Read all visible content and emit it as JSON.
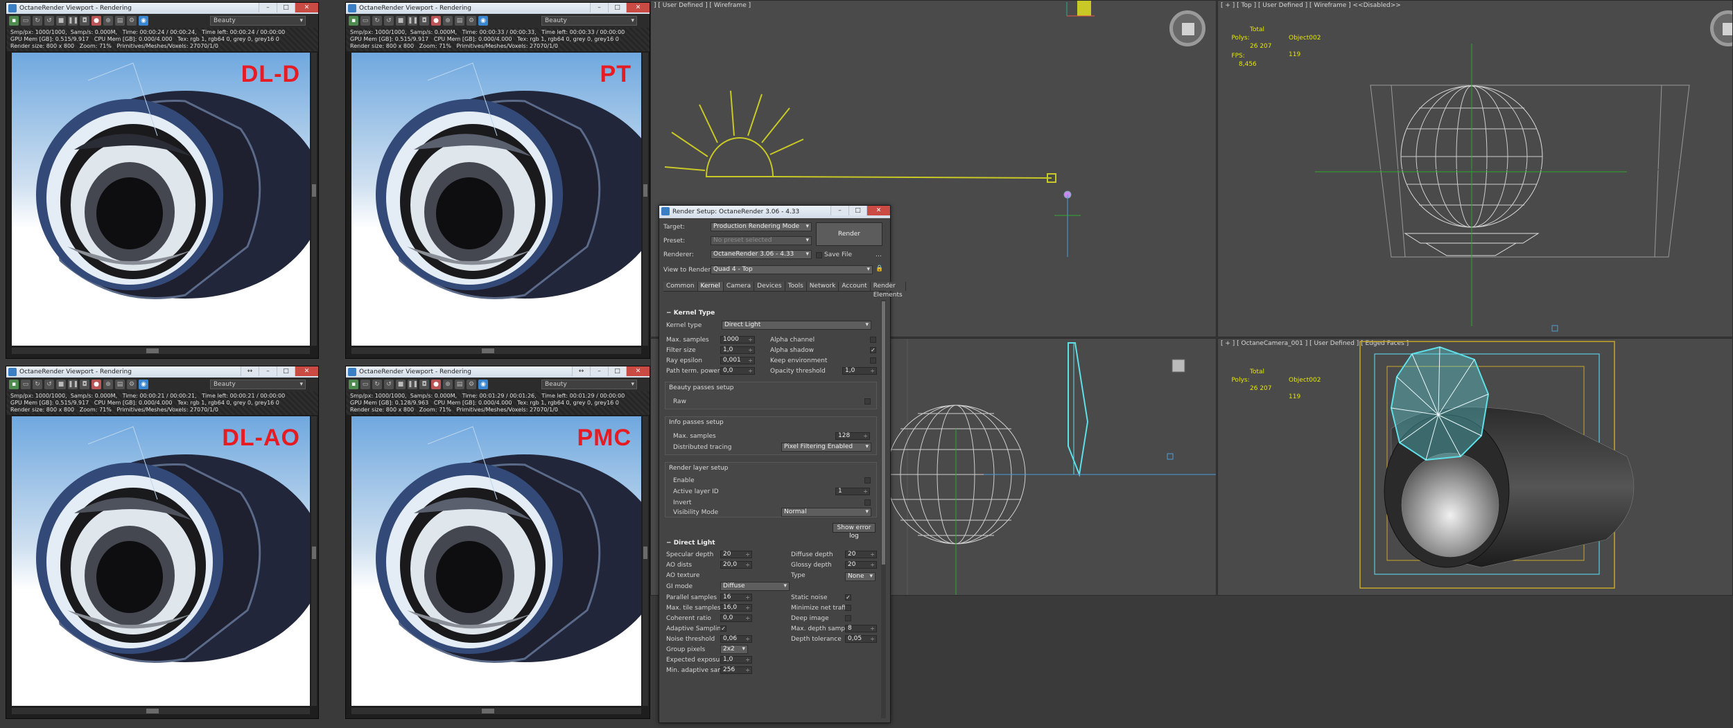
{
  "viewports": {
    "top_left_label": "] [ User Defined ] [ Wireframe ]",
    "top_right_label": "[ + ] [ Top ] [ User Defined ] [ Wireframe ] <<Disabled>>",
    "bottom_right_label": "[ + ] [ OctaneCamera_001 ] [ User Defined ] [ Edged Faces ]",
    "stats_top": {
      "col1": "Total",
      "col2": "Object002",
      "polys_label": "Polys:",
      "polys_total": "26 207",
      "polys_obj": "119",
      "fps_label": "FPS:",
      "fps_value": "8,456"
    },
    "stats_cam": {
      "col1": "Total",
      "col2": "Object002",
      "polys_label": "Polys:",
      "polys_total": "26 207",
      "polys_obj": "119"
    }
  },
  "octane_windows": [
    {
      "title": "OctaneRender Viewport - Rendering",
      "pass": "Beauty",
      "mode": "DL-D",
      "line1": "Smp/px: 1000/1000,  Samp/s: 0.000M,   Time: 00:00:24 / 00:00:24,   Time left: 00:00:24 / 00:00:00",
      "line2": "GPU Mem [GB]: 0.515/9.917   CPU Mem [GB]: 0.000/4.000   Tex: rgb 1, rgb64 0, grey 0, grey16 0",
      "line3": "Render size: 800 x 800   Zoom: 71%   Primitives/Meshes/Voxels: 27070/1/0"
    },
    {
      "title": "OctaneRender Viewport - Rendering",
      "pass": "Beauty",
      "mode": "PT",
      "line1": "Smp/px: 1000/1000,  Samp/s: 0.000M,   Time: 00:00:33 / 00:00:33,   Time left: 00:00:33 / 00:00:00",
      "line2": "GPU Mem [GB]: 0.515/9.917   CPU Mem [GB]: 0.000/4.000   Tex: rgb 1, rgb64 0, grey 0, grey16 0",
      "line3": "Render size: 800 x 800   Zoom: 71%   Primitives/Meshes/Voxels: 27070/1/0"
    },
    {
      "title": "OctaneRender Viewport - Rendering",
      "pass": "Beauty",
      "mode": "DL-AO",
      "line1": "Smp/px: 1000/1000,  Samp/s: 0.000M,   Time: 00:00:21 / 00:00:21,   Time left: 00:00:21 / 00:00:00",
      "line2": "GPU Mem [GB]: 0.515/9.917   CPU Mem [GB]: 0.000/4.000   Tex: rgb 1, rgb64 0, grey 0, grey16 0",
      "line3": "Render size: 800 x 800   Zoom: 71%   Primitives/Meshes/Voxels: 27070/1/0"
    },
    {
      "title": "OctaneRender Viewport - Rendering",
      "pass": "Beauty",
      "mode": "PMC",
      "line1": "Smp/px: 1000/1000,  Samp/s: 0.000M,   Time: 00:01:29 / 00:01:26,   Time left: 00:01:29 / 00:00:00",
      "line2": "GPU Mem [GB]: 0.128/9.963   CPU Mem [GB]: 0.000/4.000   Tex: rgb 1, rgb64 0, grey 0, grey16 0",
      "line3": "Render size: 800 x 800   Zoom: 71%   Primitives/Meshes/Voxels: 27070/1/0"
    }
  ],
  "render_setup": {
    "title": "Render Setup: OctaneRender 3.06 - 4.33",
    "target_label": "Target:",
    "target_value": "Production Rendering Mode",
    "preset_label": "Preset:",
    "preset_value": "No preset selected",
    "renderer_label": "Renderer:",
    "renderer_value": "OctaneRender 3.06 - 4.33",
    "save_file": "Save File",
    "view_label": "View to Render:",
    "view_value": "Quad 4 - Top",
    "render_button": "Render",
    "tabs": [
      "Common",
      "Kernel",
      "Camera",
      "Devices",
      "Tools",
      "Network",
      "Account",
      "Render Elements"
    ],
    "kernel": {
      "header": "Kernel Type",
      "kernel_type_label": "Kernel type",
      "kernel_type_value": "Direct Light",
      "max_samples_label": "Max. samples",
      "max_samples": "1000",
      "filter_size_label": "Filter size",
      "filter_size": "1,0",
      "ray_epsilon_label": "Ray epsilon",
      "ray_epsilon": "0,001",
      "path_term_label": "Path term. power",
      "path_term": "0,0",
      "alpha_channel_label": "Alpha channel",
      "alpha_shadow_label": "Alpha shadow",
      "keep_env_label": "Keep environment",
      "opacity_label": "Opacity threshold",
      "opacity": "1,0"
    },
    "beauty": {
      "header": "Beauty passes setup",
      "raw_label": "Raw"
    },
    "info": {
      "header": "Info passes setup",
      "max_samples_label": "Max. samples",
      "max_samples": "128",
      "dist_label": "Distributed tracing",
      "dist_value": "Pixel Filtering Enabled"
    },
    "layer": {
      "header": "Render layer setup",
      "enable_label": "Enable",
      "active_label": "Active layer ID",
      "active_value": "1",
      "invert_label": "Invert",
      "visibility_label": "Visibility Mode",
      "visibility_value": "Normal"
    },
    "error_log_button": "Show error log",
    "direct": {
      "header": "Direct Light",
      "spec_label": "Specular depth",
      "spec": "20",
      "ao_dist_label": "AO dists",
      "ao_dist": "20,0",
      "ao_tex_label": "AO texture",
      "gi_label": "GI mode",
      "gi_value": "Diffuse",
      "diff_label": "Diffuse depth",
      "diff": "20",
      "gloss_label": "Glossy depth",
      "gloss": "20",
      "type_label": "Type",
      "type_value": "None",
      "par_label": "Parallel samples",
      "par": "16",
      "tile_label": "Max. tile samples",
      "tile": "16,0",
      "coh_label": "Coherent ratio",
      "coh": "0,0",
      "adapt_label": "Adaptive Sampling",
      "noise_label": "Noise threshold",
      "noise": "0,06",
      "group_label": "Group pixels",
      "group_value": "2x2",
      "exp_label": "Expected exposure",
      "exp": "1,0",
      "min_label": "Min. adaptive sample",
      "min": "256",
      "static_label": "Static noise",
      "min_net_label": "Minimize net traffic",
      "deep_label": "Deep image",
      "max_depth_label": "Max. depth samples",
      "max_depth": "8",
      "depth_tol_label": "Depth tolerance",
      "depth_tol": "0,05"
    }
  },
  "colors": {
    "accent_red": "#e51c23",
    "gizmo_yellow": "#cccc22",
    "select_cyan": "#5ee0e8"
  }
}
